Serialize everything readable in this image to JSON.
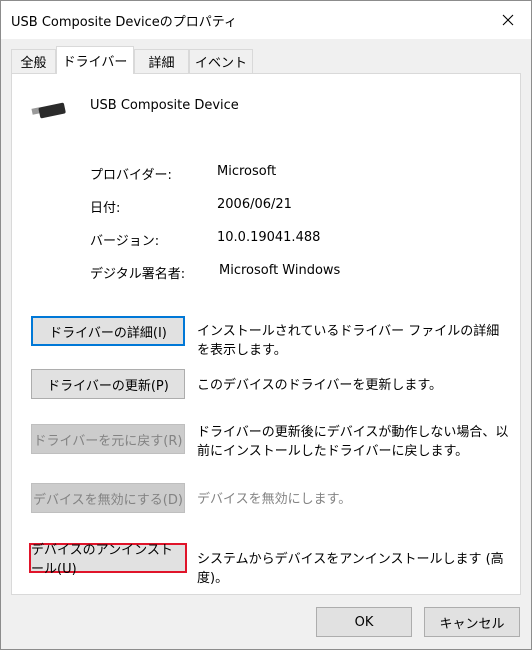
{
  "window": {
    "title": "USB Composite Deviceのプロパティ"
  },
  "tabs": [
    {
      "label": "全般"
    },
    {
      "label": "ドライバー"
    },
    {
      "label": "詳細"
    },
    {
      "label": "イベント"
    }
  ],
  "device": {
    "name": "USB Composite Device",
    "icon": "usb-connector-icon"
  },
  "properties": [
    {
      "label": "プロバイダー:",
      "value": "Microsoft"
    },
    {
      "label": "日付:",
      "value": "2006/06/21"
    },
    {
      "label": "バージョン:",
      "value": "10.0.19041.488"
    },
    {
      "label": "デジタル署名者:",
      "value": "Microsoft Windows"
    }
  ],
  "actions": [
    {
      "label": "ドライバーの詳細(I)",
      "description": "インストールされているドライバー ファイルの詳細を表示します。",
      "state": "focused"
    },
    {
      "label": "ドライバーの更新(P)",
      "description": "このデバイスのドライバーを更新します。",
      "state": "normal"
    },
    {
      "label": "ドライバーを元に戻す(R)",
      "description": "ドライバーの更新後にデバイスが動作しない場合、以前にインストールしたドライバーに戻します。",
      "state": "disabled"
    },
    {
      "label": "デバイスを無効にする(D)",
      "description": "デバイスを無効にします。",
      "state": "disabled"
    },
    {
      "label": "デバイスのアンインストール(U)",
      "description": "システムからデバイスをアンインストールします (高度)。",
      "state": "highlighted"
    }
  ],
  "footer": {
    "ok_label": "OK",
    "cancel_label": "キャンセル"
  },
  "colors": {
    "focus_border": "#0078d7",
    "highlight_border": "#e0142a",
    "disabled_text": "#838383"
  }
}
